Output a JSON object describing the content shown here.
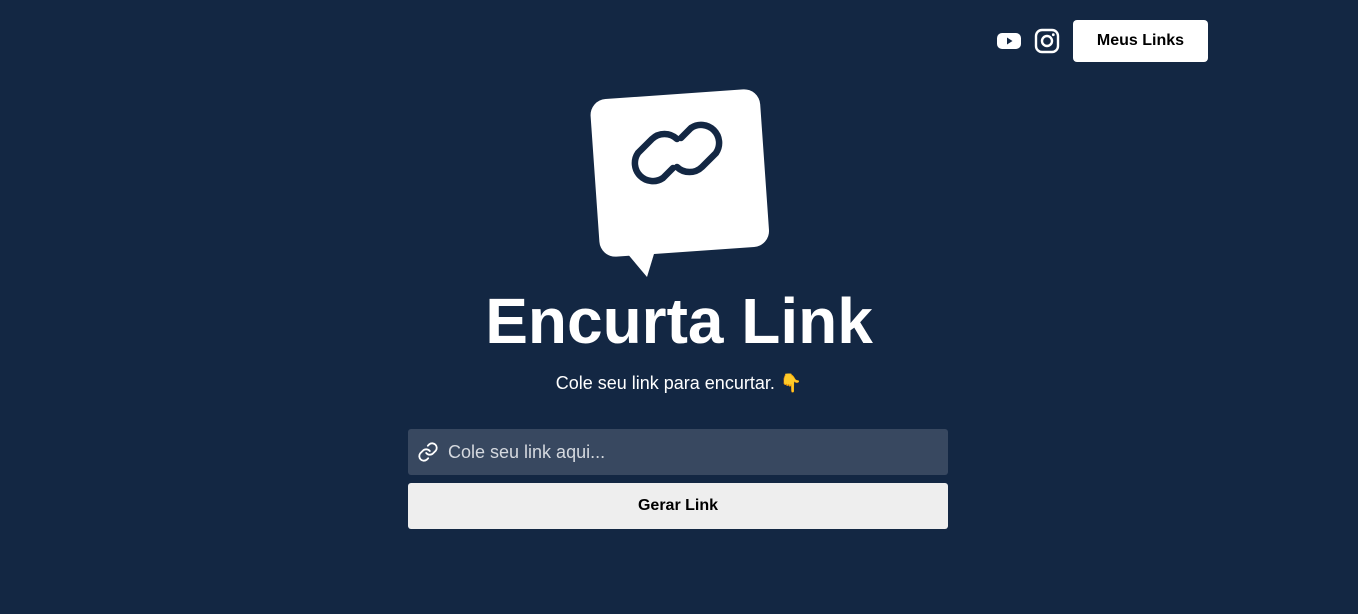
{
  "header": {
    "youtube_icon": "youtube-icon",
    "instagram_icon": "instagram-icon",
    "my_links_label": "Meus Links"
  },
  "hero": {
    "title": "Encurta Link",
    "subtitle": "Cole seu link para encurtar. 👇"
  },
  "form": {
    "placeholder": "Cole seu link aqui...",
    "value": "",
    "submit_label": "Gerar Link"
  },
  "colors": {
    "background": "#132743",
    "input_bg": "#384860",
    "button_bg": "#eeeeee"
  }
}
